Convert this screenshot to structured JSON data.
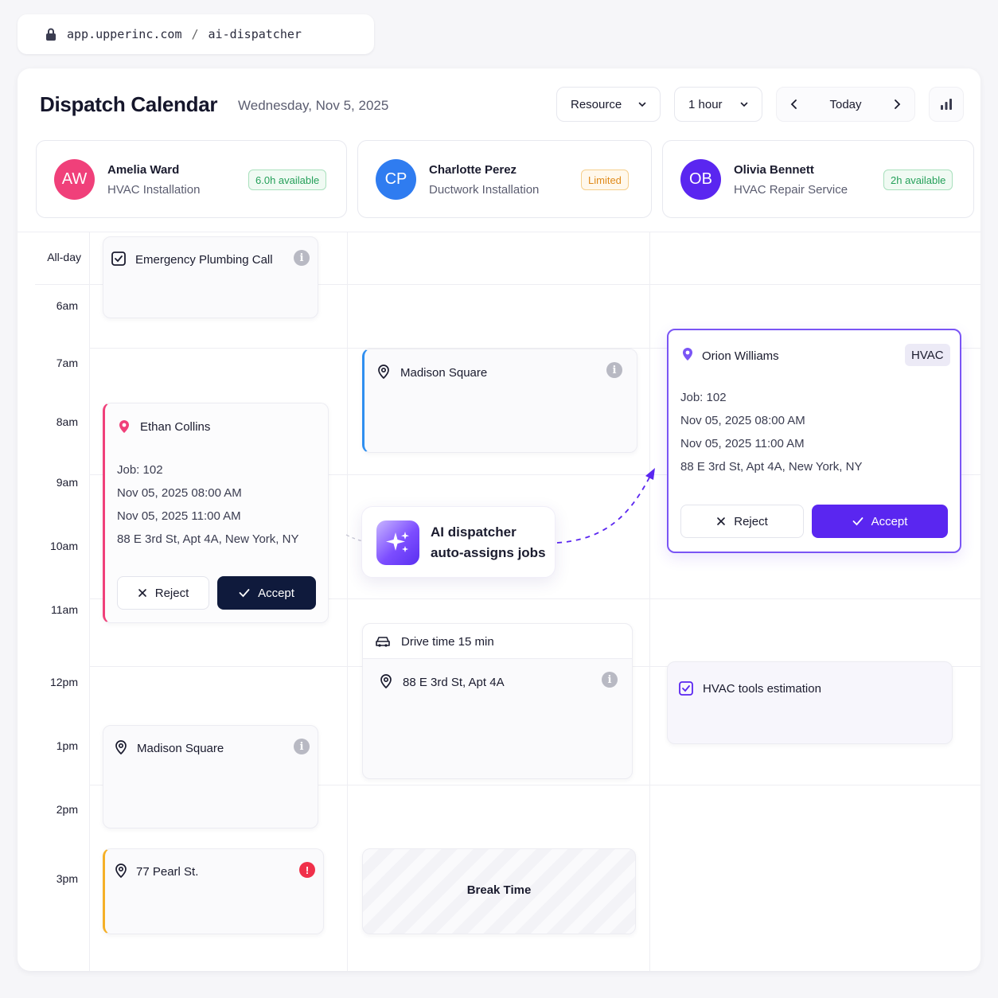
{
  "browser": {
    "domain": "app.upperinc.com",
    "separator": "/",
    "path": "ai-dispatcher"
  },
  "header": {
    "title": "Dispatch Calendar",
    "date": "Wednesday, Nov 5, 2025",
    "view_select": "Resource",
    "interval_select": "1 hour",
    "today_label": "Today"
  },
  "resources": [
    {
      "initials": "AW",
      "name": "Amelia Ward",
      "role": "HVAC Installation",
      "badge": "6.0h available",
      "color": "#f0407a"
    },
    {
      "initials": "CP",
      "name": "Charlotte Perez",
      "role": "Ductwork Installation",
      "badge": "Limited",
      "color": "#2f7cf0"
    },
    {
      "initials": "OB",
      "name": "Olivia Bennett",
      "role": "HVAC Repair Service",
      "badge": "2h available",
      "color": "#5a26f0"
    }
  ],
  "times": [
    "All-day",
    "6am",
    "7am",
    "8am",
    "9am",
    "10am",
    "11am",
    "12pm",
    "1pm",
    "2pm",
    "3pm"
  ],
  "events": {
    "emergency": {
      "title": "Emergency Plumbing Call"
    },
    "madison_top": {
      "title": "Madison Square"
    },
    "ethan": {
      "name": "Ethan Collins",
      "job": "Job: 102",
      "start": "Nov 05, 2025 08:00 AM",
      "end": "Nov 05, 2025 11:00 AM",
      "address": "88 E 3rd St, Apt 4A, New York, NY",
      "reject": "Reject",
      "accept": "Accept"
    },
    "orion": {
      "name": "Orion Williams",
      "tag": "HVAC",
      "job": "Job: 102",
      "start": "Nov 05, 2025 08:00 AM",
      "end": "Nov 05, 2025 11:00 AM",
      "address": "88 E 3rd St, Apt 4A, New York, NY",
      "reject": "Reject",
      "accept": "Accept"
    },
    "drive": {
      "title": "Drive time 15 min"
    },
    "third_st": {
      "title": "88 E 3rd St, Apt 4A"
    },
    "hvac_tools": {
      "title": "HVAC tools estimation"
    },
    "madison_bottom": {
      "title": "Madison Square"
    },
    "pearl": {
      "title": "77 Pearl St."
    },
    "break": {
      "title": "Break Time"
    }
  },
  "ai_callout": {
    "line1": "AI dispatcher",
    "line2": "auto-assigns jobs"
  },
  "colors": {
    "accent_purple": "#5a26f0",
    "dark_navy": "#0f1a3c",
    "pink": "#f0407a",
    "blue": "#2f7cf0",
    "amber": "#f5b027"
  }
}
